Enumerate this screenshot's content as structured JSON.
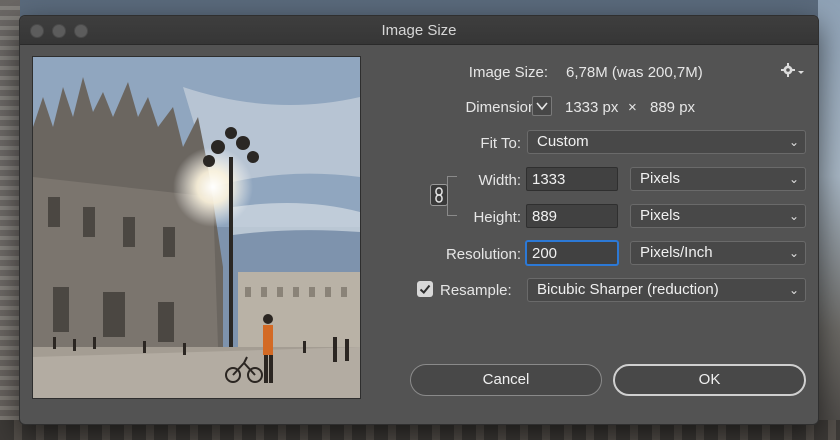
{
  "window": {
    "title": "Image Size"
  },
  "image_size": {
    "label": "Image Size:",
    "value": "6,78M (was 200,7M)"
  },
  "dimensions": {
    "label": "Dimensions:",
    "width": "1333 px",
    "times": "×",
    "height": "889 px"
  },
  "fit_to": {
    "label": "Fit To:",
    "value": "Custom"
  },
  "width": {
    "label": "Width:",
    "value": "1333",
    "unit": "Pixels"
  },
  "height": {
    "label": "Height:",
    "value": "889",
    "unit": "Pixels"
  },
  "resolution": {
    "label": "Resolution:",
    "value": "200",
    "unit": "Pixels/Inch"
  },
  "resample": {
    "label": "Resample:",
    "checked": true,
    "value": "Bicubic Sharper (reduction)"
  },
  "buttons": {
    "cancel": "Cancel",
    "ok": "OK"
  },
  "icons": {
    "settings": "gear-icon",
    "link": "chain-link-icon",
    "dimensions": "chevron-down-icon"
  },
  "colors": {
    "dialog_bg": "#535353",
    "focus": "#2c79d6"
  }
}
